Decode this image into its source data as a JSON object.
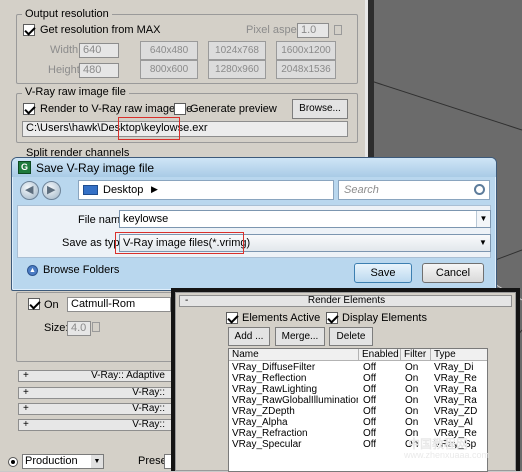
{
  "output_resolution": {
    "title": "Output resolution",
    "get_from_max_label": "Get resolution from MAX",
    "get_from_max_checked": true,
    "pixel_aspect_label": "Pixel aspect",
    "pixel_aspect_value": "1.0",
    "width_label": "Width",
    "width_value": "640",
    "height_label": "Height",
    "height_value": "480",
    "presets": [
      "640x480",
      "1024x768",
      "1600x1200",
      "800x600",
      "1280x960",
      "2048x1536"
    ]
  },
  "raw_image": {
    "title": "V-Ray raw image file",
    "render_label": "Render to V-Ray raw image file",
    "render_checked": true,
    "preview_label": "Generate preview",
    "preview_checked": false,
    "browse_label": "Browse...",
    "path_prefix": "C:\\Users\\hawk\\Desktop\\",
    "path_file": "keylowse.exr"
  },
  "split_channels": {
    "title": "Split render channels"
  },
  "filter": {
    "on_label": "On",
    "on_checked": true,
    "filter_name": "Catmull-Rom",
    "size_label": "Size:",
    "size_value": "4.0"
  },
  "rollouts": [
    "V-Ray:: Adaptive",
    "V-Ray::",
    "V-Ray::",
    "V-Ray::"
  ],
  "dialog": {
    "title": "Save V-Ray image file",
    "icon_letter": "G",
    "location": "Desktop",
    "search_placeholder": "Search",
    "file_name_label": "File name:",
    "file_name_value": "keylowse",
    "save_type_label": "Save as type:",
    "save_type_value": "V-Ray image files(*.vrimg)",
    "browse_folders_label": "Browse Folders",
    "save_label": "Save",
    "cancel_label": "Cancel"
  },
  "render_elements": {
    "title": "Render Elements",
    "elements_active_label": "Elements Active",
    "elements_active_checked": true,
    "display_elements_label": "Display Elements",
    "display_elements_checked": true,
    "add_label": "Add ...",
    "merge_label": "Merge...",
    "delete_label": "Delete",
    "columns": [
      "Name",
      "Enabled",
      "Filter",
      "Type"
    ],
    "rows": [
      [
        "VRay_DiffuseFilter",
        "Off",
        "On",
        "VRay_Di"
      ],
      [
        "VRay_Reflection",
        "Off",
        "On",
        "VRay_Re"
      ],
      [
        "VRay_RawLighting",
        "Off",
        "On",
        "VRay_Ra"
      ],
      [
        "VRay_RawGlobalIllumination",
        "Off",
        "On",
        "VRay_Ra"
      ],
      [
        "VRay_ZDepth",
        "Off",
        "On",
        "VRay_ZD"
      ],
      [
        "VRay_Alpha",
        "Off",
        "On",
        "VRay_Al"
      ],
      [
        "VRay_Refraction",
        "Off",
        "On",
        "VRay_Re"
      ],
      [
        "VRay_Specular",
        "Off",
        "On",
        "VRay_Sp"
      ]
    ]
  },
  "bottom_bar": {
    "production_label": "Production",
    "preset_label": "Preset:"
  },
  "watermark": {
    "line1": "中国教程网",
    "line2": "www.zhenxuaaa.com"
  },
  "colors": {
    "highlight": "#d9302b",
    "dialog_frame": "#b9d7ee",
    "panel_bg": "#d4d0c8"
  }
}
